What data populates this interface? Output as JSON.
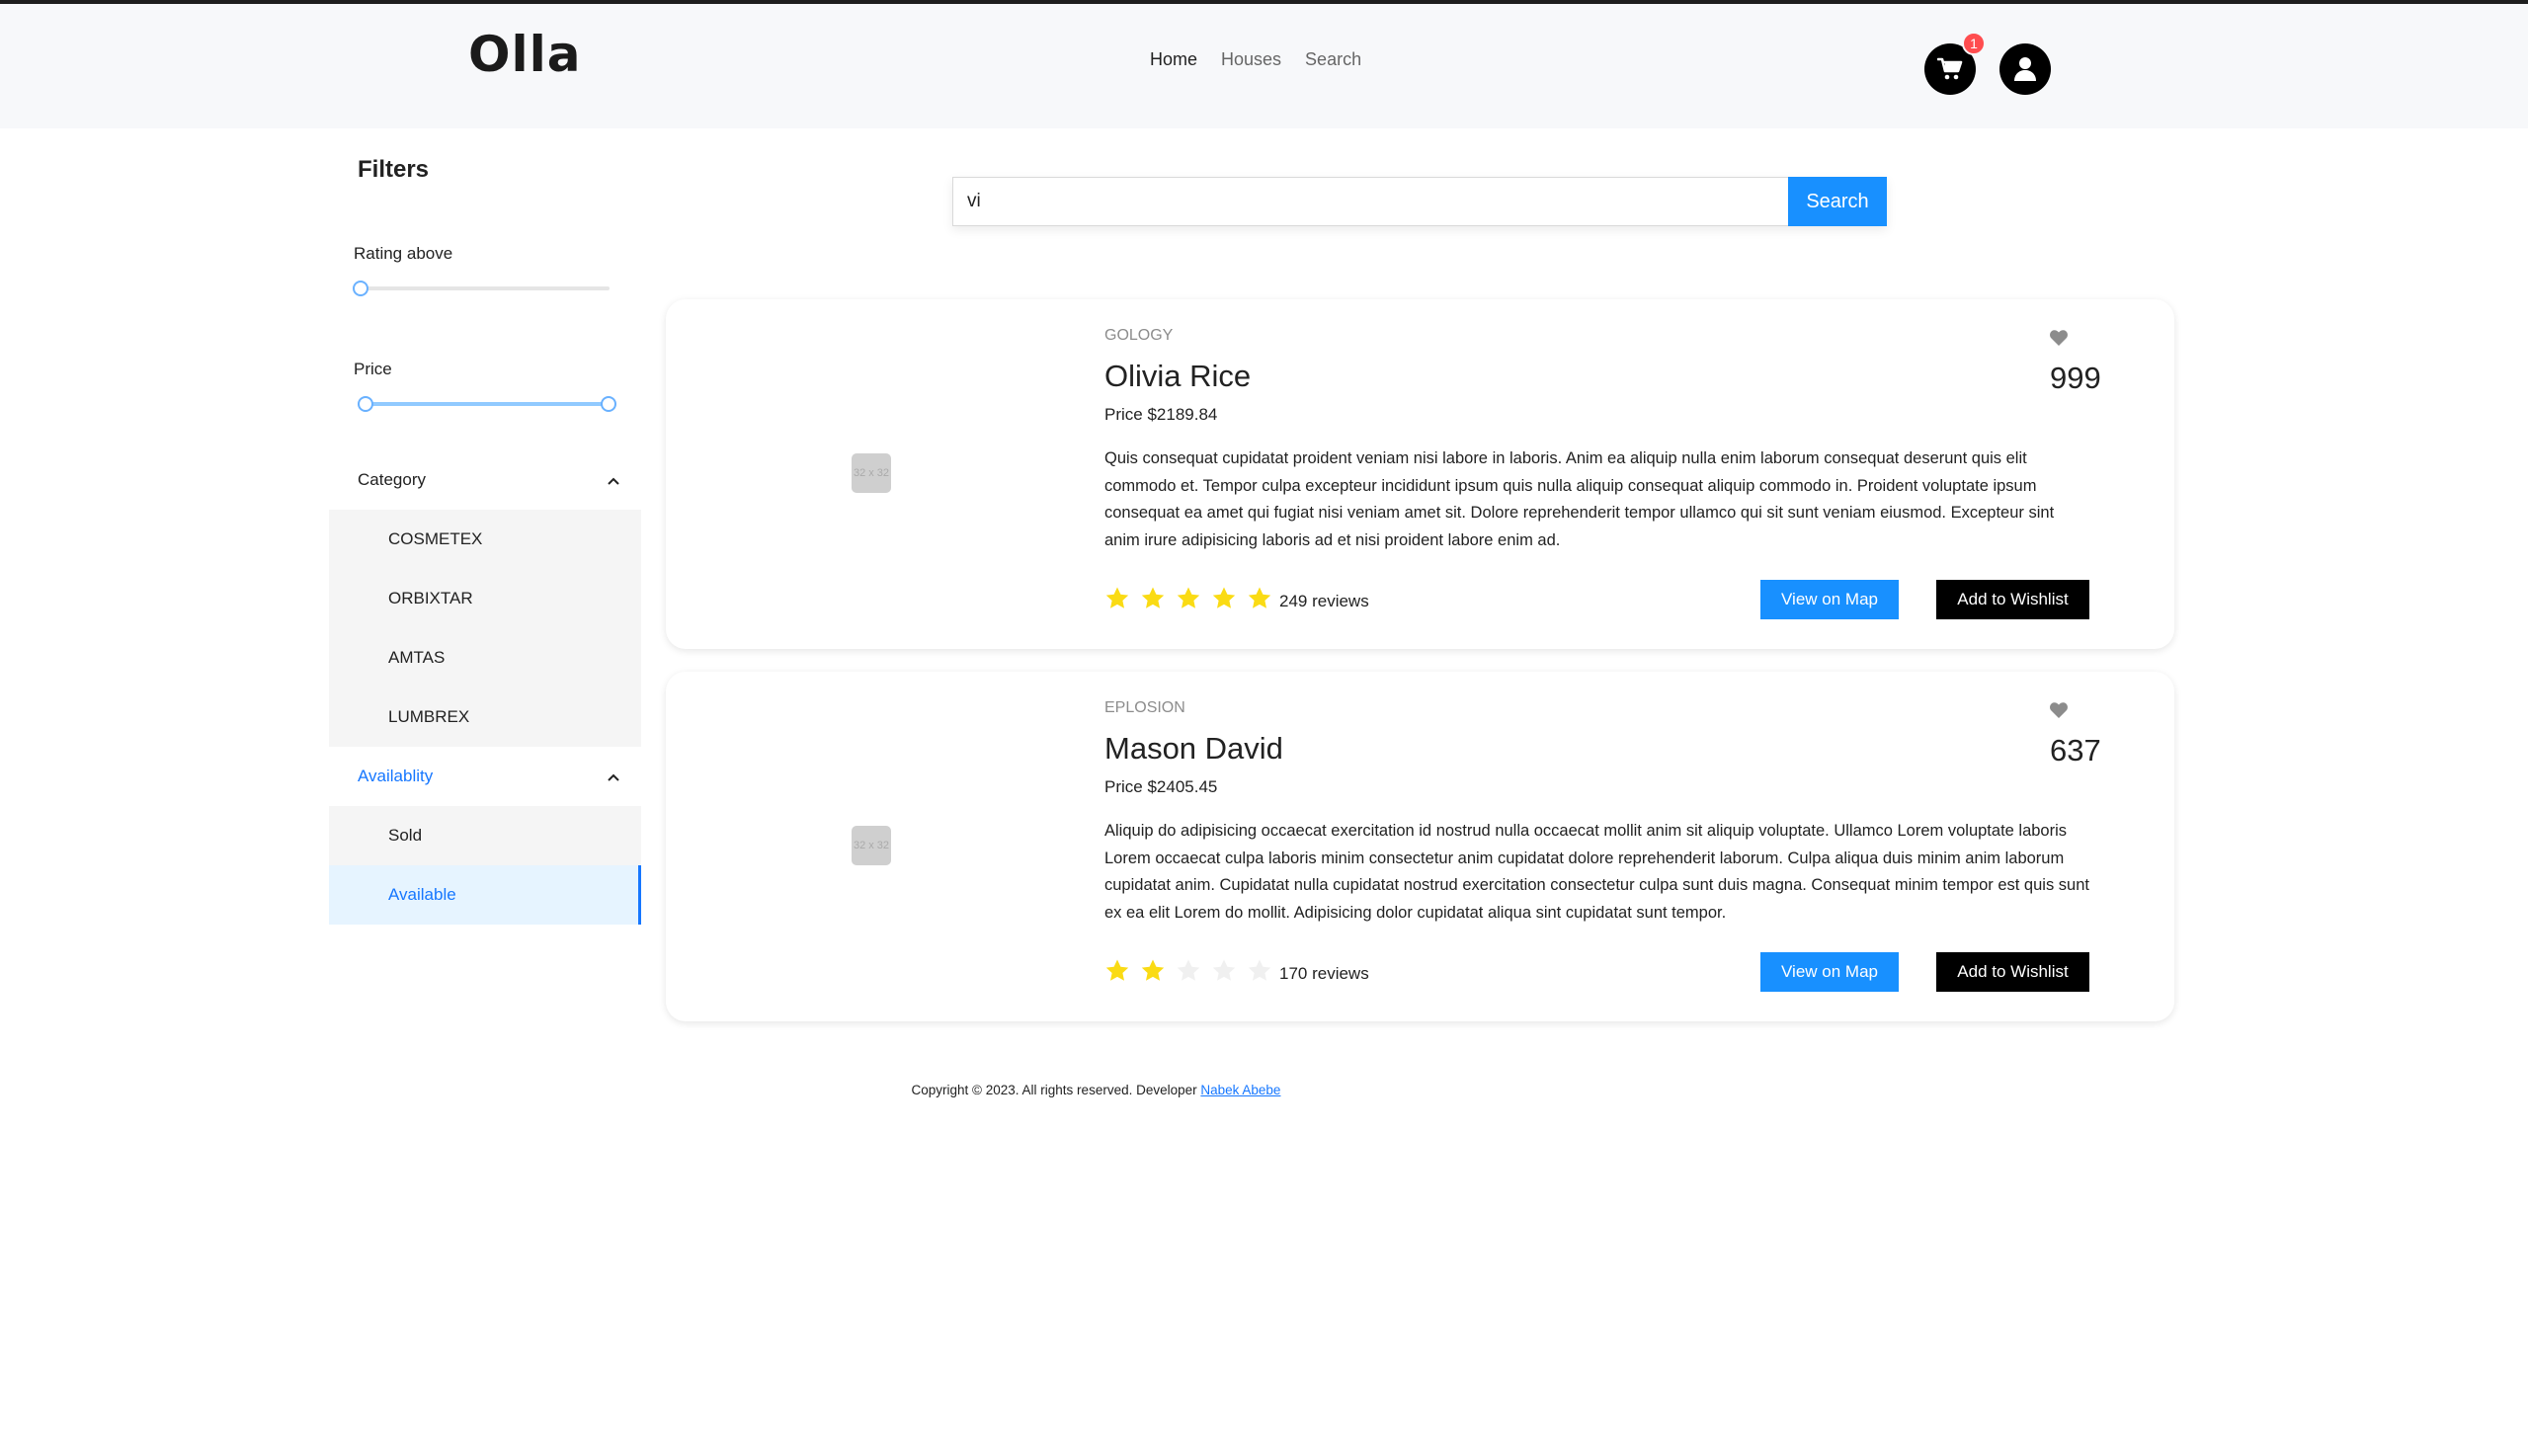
{
  "header": {
    "logo": "Olla",
    "nav": [
      "Home",
      "Houses",
      "Search"
    ],
    "cart_count": "1"
  },
  "filters": {
    "title": "Filters",
    "rating_label": "Rating above",
    "rating_value": 0,
    "price_label": "Price",
    "price_range": [
      0,
      1
    ],
    "category": {
      "label": "Category",
      "items": [
        "COSMETEX",
        "ORBIXTAR",
        "AMTAS",
        "LUMBREX"
      ]
    },
    "availability": {
      "label": "Availablity",
      "items": [
        "Sold",
        "Available"
      ],
      "selected": "Available"
    }
  },
  "search": {
    "value": "vi",
    "button": "Search"
  },
  "listings": [
    {
      "category": "GOLOGY",
      "name": "Olivia Rice",
      "price": "Price $2189.84",
      "description": "Quis consequat cupidatat proident veniam nisi labore in laboris. Anim ea aliquip nulla enim laborum consequat deserunt quis elit commodo et. Tempor culpa excepteur incididunt ipsum quis nulla aliquip consequat aliquip commodo in. Proident voluptate ipsum consequat ea amet qui fugiat nisi veniam amet sit. Dolore reprehenderit tempor ullamco qui sit sunt veniam eiusmod. Excepteur sint anim irure adipisicing laboris ad et nisi proident labore enim ad.",
      "likes": "999",
      "rating": 5,
      "reviews": "249 reviews",
      "thumb_text": "32 x 32",
      "map_button": "View on Map",
      "wishlist_button": "Add to Wishlist"
    },
    {
      "category": "EPLOSION",
      "name": "Mason David",
      "price": "Price $2405.45",
      "description": "Aliquip do adipisicing occaecat exercitation id nostrud nulla occaecat mollit anim sit aliquip voluptate. Ullamco Lorem voluptate laboris Lorem occaecat culpa laboris minim consectetur anim cupidatat dolore reprehenderit laborum. Culpa aliqua duis minim anim laborum cupidatat anim. Cupidatat nulla cupidatat nostrud exercitation consectetur culpa sunt duis magna. Consequat minim tempor est quis sunt ex ea elit Lorem do mollit. Adipisicing dolor cupidatat aliqua sint cupidatat sunt tempor.",
      "likes": "637",
      "rating": 2,
      "reviews": "170 reviews",
      "thumb_text": "32 x 32",
      "map_button": "View on Map",
      "wishlist_button": "Add to Wishlist"
    }
  ],
  "footer": {
    "text": "Copyright © 2023. All rights reserved. Developer ",
    "link": "Nabek Abebe"
  },
  "colors": {
    "primary": "#1890ff",
    "star": "#fadb14",
    "star_empty": "#f0f0f0",
    "badge": "#ff4d4f"
  }
}
